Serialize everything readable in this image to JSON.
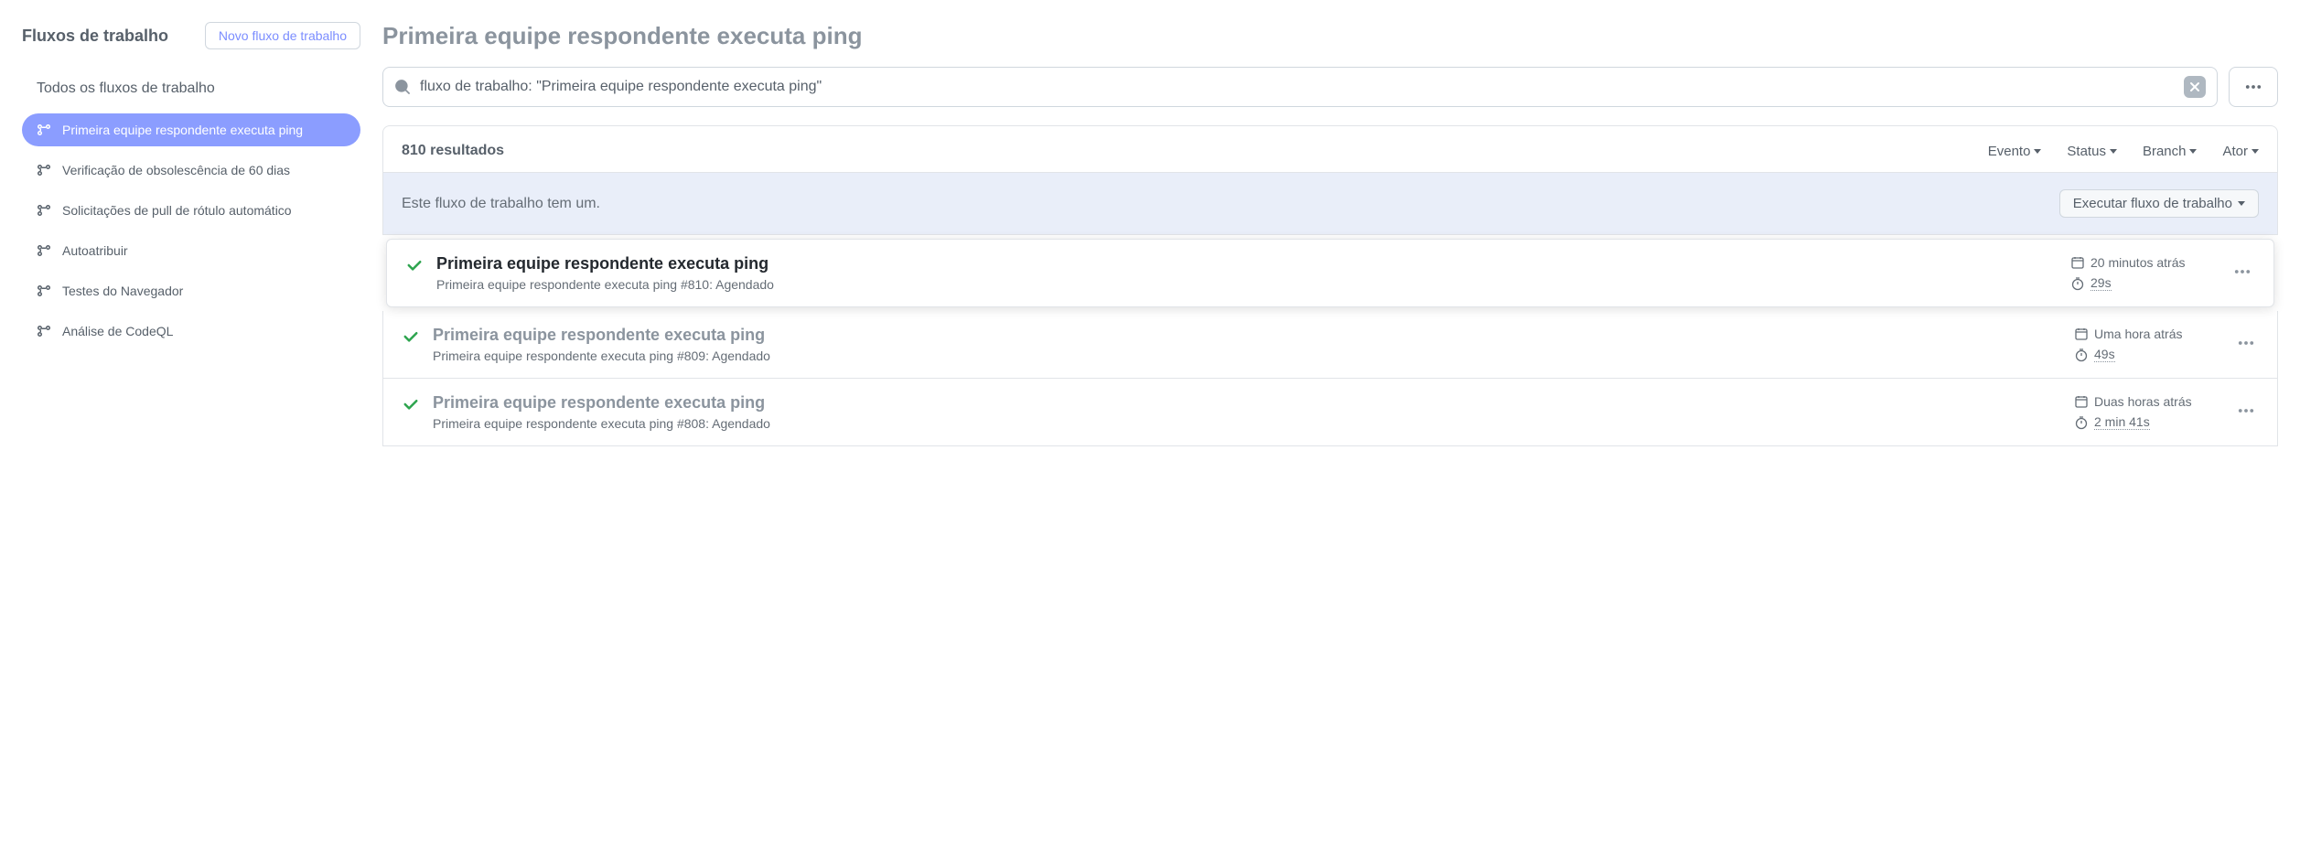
{
  "sidebar": {
    "title": "Fluxos de trabalho",
    "new_button": "Novo fluxo de trabalho",
    "all_label": "Todos os fluxos de trabalho",
    "items": [
      "Primeira equipe respondente executa ping",
      "Verificação de obsolescência de 60 dias",
      "Solicitações de pull de rótulo automático",
      "Autoatribuir",
      "Testes do Navegador",
      "Análise de CodeQL"
    ]
  },
  "main": {
    "title": "Primeira equipe respondente executa ping",
    "search_value": "fluxo de trabalho: \"Primeira equipe respondente executa ping\"",
    "results_count": "810 resultados",
    "filters": {
      "event": "Evento",
      "status": "Status",
      "branch": "Branch",
      "actor": "Ator"
    },
    "dispatch_text": "Este fluxo de trabalho tem um.",
    "run_workflow_label": "Executar fluxo de trabalho",
    "runs": [
      {
        "title": "Primeira equipe respondente executa ping",
        "subtitle": "Primeira equipe respondente executa ping #810: Agendado",
        "time": "20 minutos atrás",
        "duration": "29s"
      },
      {
        "title": "Primeira equipe respondente executa ping",
        "subtitle": "Primeira equipe respondente executa ping #809: Agendado",
        "time": "Uma hora atrás",
        "duration": "49s"
      },
      {
        "title": "Primeira equipe respondente executa ping",
        "subtitle": "Primeira equipe respondente executa ping #808: Agendado",
        "time": "Duas horas atrás",
        "duration": "2 min 41s"
      }
    ]
  }
}
